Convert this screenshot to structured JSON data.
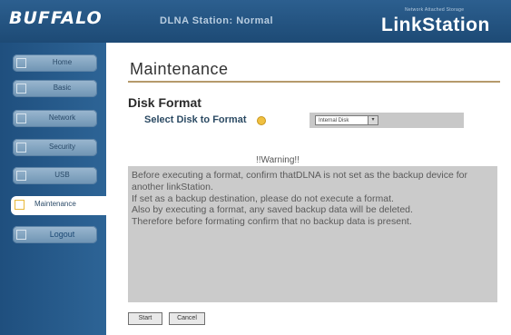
{
  "header": {
    "logo": "BUFFALO",
    "status": "DLNA Station: Normal",
    "brand_tag": "Network Attached Storage",
    "brand": "LinkStation"
  },
  "sidebar": {
    "items": [
      {
        "label": "Home"
      },
      {
        "label": "Basic"
      },
      {
        "label": "Network"
      },
      {
        "label": "Security"
      },
      {
        "label": "USB"
      },
      {
        "label": "Maintenance",
        "active": true
      },
      {
        "label": "Logout"
      }
    ]
  },
  "main": {
    "title": "Maintenance",
    "section": "Disk Format",
    "select_label": "Select Disk to Format",
    "disk_select_value": "Internal Disk",
    "warning_title": "!!Warning!!",
    "warning_text": "Before executing a format, confirm thatDLNA is not set as the backup device for another linkStation.\nIf set as a backup destination, please do not execute a format.\nAlso by executing a format, any saved backup data will be deleted.\nTherefore before formating confirm that no backup data is present.",
    "start_label": "Start",
    "cancel_label": "Cancel"
  },
  "colors": {
    "header_bg": "#1d4a75",
    "sidebar_bg": "#2d6496",
    "title_rule": "#b59a6b",
    "warning_bg": "#cbcbcb",
    "help_icon": "#f0c040"
  }
}
